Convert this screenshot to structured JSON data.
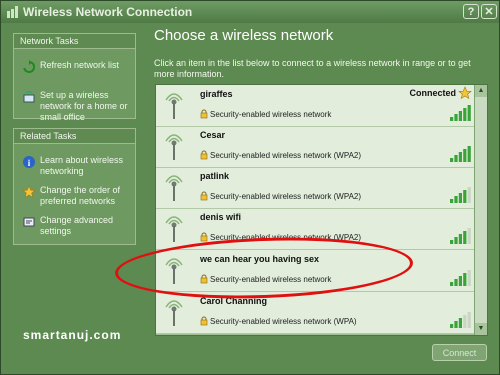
{
  "window": {
    "title": "Wireless Network Connection",
    "close_glyph": "✕",
    "help_glyph": "?"
  },
  "network_tasks": {
    "header": "Network Tasks",
    "items": [
      {
        "label": "Refresh network list",
        "icon": "refresh-icon"
      },
      {
        "label": "Set up a wireless network for a home or small office",
        "icon": "setup-wireless-icon"
      }
    ]
  },
  "related_tasks": {
    "header": "Related Tasks",
    "items": [
      {
        "label": "Learn about wireless networking",
        "icon": "info-icon"
      },
      {
        "label": "Change the order of preferred networks",
        "icon": "star-icon"
      },
      {
        "label": "Change advanced settings",
        "icon": "settings-icon"
      }
    ]
  },
  "main": {
    "title": "Choose a wireless network",
    "description": "Click an item in the list below to connect to a wireless network in range or to get more information.",
    "connect_button": "Connect"
  },
  "networks": [
    {
      "name": "giraffes",
      "security": "Security-enabled wireless network",
      "status": "Connected",
      "signal_bars": 5
    },
    {
      "name": "Cesar",
      "security": "Security-enabled wireless network (WPA2)",
      "status": "",
      "signal_bars": 5
    },
    {
      "name": "patlink",
      "security": "Security-enabled wireless network (WPA2)",
      "status": "",
      "signal_bars": 4
    },
    {
      "name": "denis wifi",
      "security": "Security-enabled wireless network (WPA2)",
      "status": "",
      "signal_bars": 4
    },
    {
      "name": "we can hear you having sex",
      "security": "Security-enabled wireless network",
      "status": "",
      "signal_bars": 4
    },
    {
      "name": "Carol Channing",
      "security": "Security-enabled wireless network (WPA)",
      "status": "",
      "signal_bars": 3
    }
  ],
  "watermark": "smartanuj.com",
  "colors": {
    "accent_green": "#5d8a50",
    "list_bg": "#e2eddc",
    "signal_active": "#3aa43a",
    "annotation_red": "#e01010"
  }
}
